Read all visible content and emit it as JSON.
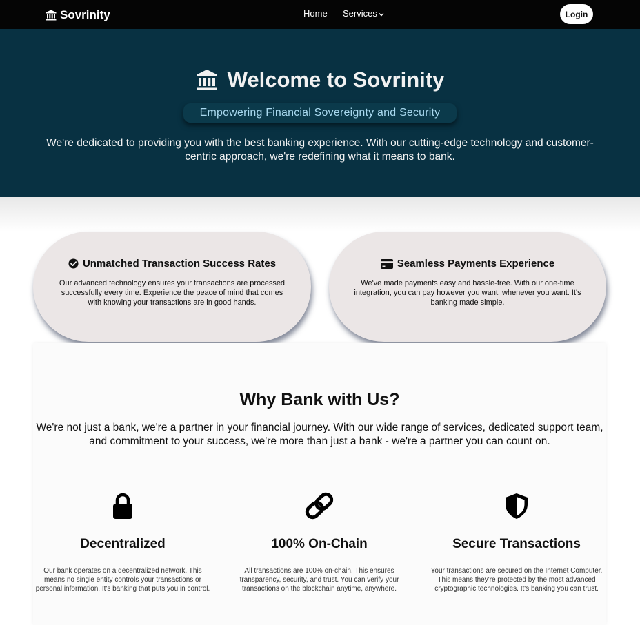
{
  "nav": {
    "brand": "Sovrinity",
    "brand_icon": "bank-icon",
    "links": [
      {
        "label": "Home"
      },
      {
        "label": "Services",
        "icon": "chevron-down-icon"
      }
    ],
    "login_label": "Login"
  },
  "hero": {
    "title": "Welcome to Sovrinity",
    "title_icon": "bank-icon",
    "subtitle": "Empowering Financial Sovereignty and Security",
    "description": "We're dedicated to providing you with the best banking experience. With our cutting-edge technology and customer-centric approach, we're redefining what it means to bank.",
    "background_color": "#083142"
  },
  "features": [
    {
      "icon": "check-circle-icon",
      "title": "Unmatched Transaction Success Rates",
      "text": "Our advanced technology ensures your transactions are processed successfully every time. Experience the peace of mind that comes with knowing your transactions are in good hands."
    },
    {
      "icon": "credit-card-icon",
      "title": "Seamless Payments Experience",
      "text": "We've made payments easy and hassle-free. With our one-time integration, you can pay however you want, whenever you want. It's banking made simple."
    }
  ],
  "why": {
    "title": "Why Bank with Us?",
    "description": "We're not just a bank, we're a partner in your financial journey. With our wide range of services, dedicated support team, and commitment to your success, we're more than just a bank - we're a partner you can count on.",
    "columns": [
      {
        "icon": "lock-icon",
        "title": "Decentralized",
        "text": "Our bank operates on a decentralized network. This means no single entity controls your transactions or personal information. It's banking that puts you in control."
      },
      {
        "icon": "link-icon",
        "title": "100% On-Chain",
        "text": "All transactions are 100% on-chain. This ensures transparency, security, and trust. You can verify your transactions on the blockchain anytime, anywhere."
      },
      {
        "icon": "shield-icon",
        "title": "Secure Transactions",
        "text": "Your transactions are secured on the Internet Computer. This means they're protected by the most advanced cryptographic technologies. It's banking you can trust."
      }
    ]
  }
}
